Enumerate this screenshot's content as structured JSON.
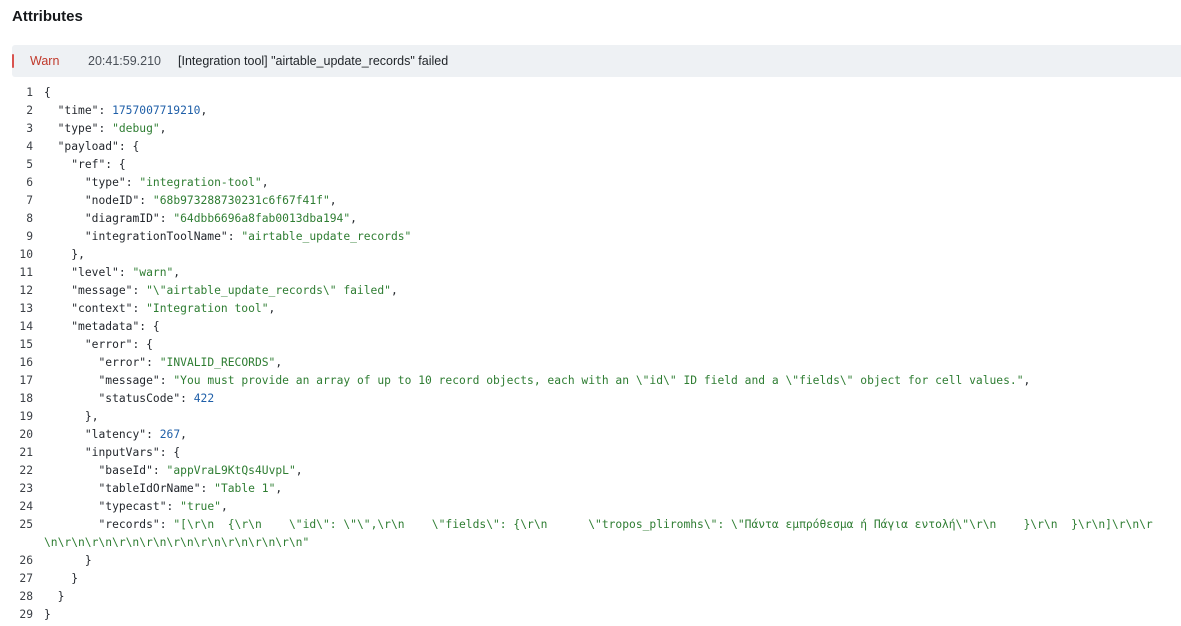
{
  "section": {
    "title": "Attributes"
  },
  "log": {
    "level": "Warn",
    "time": "20:41:59.210",
    "message": "[Integration tool] \"airtable_update_records\" failed",
    "accent_color": "#d9534f"
  },
  "code": {
    "line_numbers": [
      "1",
      "2",
      "3",
      "4",
      "5",
      "6",
      "7",
      "8",
      "9",
      "10",
      "11",
      "12",
      "13",
      "14",
      "15",
      "16",
      "17",
      "18",
      "19",
      "20",
      "21",
      "22",
      "23",
      "24",
      "25",
      "26",
      "27",
      "28",
      "29"
    ],
    "lines": [
      "{",
      "  \"time\": 1757007719210,",
      "  \"type\": \"debug\",",
      "  \"payload\": {",
      "    \"ref\": {",
      "      \"type\": \"integration-tool\",",
      "      \"nodeID\": \"68b973288730231c6f67f41f\",",
      "      \"diagramID\": \"64dbb6696a8fab0013dba194\",",
      "      \"integrationToolName\": \"airtable_update_records\"",
      "    },",
      "    \"level\": \"warn\",",
      "    \"message\": \"\\\"airtable_update_records\\\" failed\",",
      "    \"context\": \"Integration tool\",",
      "    \"metadata\": {",
      "      \"error\": {",
      "        \"error\": \"INVALID_RECORDS\",",
      "        \"message\": \"You must provide an array of up to 10 record objects, each with an \\\"id\\\" ID field and a \\\"fields\\\" object for cell values.\",",
      "        \"statusCode\": 422",
      "      },",
      "      \"latency\": 267,",
      "      \"inputVars\": {",
      "        \"baseId\": \"appVraL9KtQs4UvpL\",",
      "        \"tableIdOrName\": \"Table 1\",",
      "        \"typecast\": \"true\",",
      "        \"records\": \"[\\r\\n  {\\r\\n    \\\"id\\\": \\\"\\\",\\r\\n    \\\"fields\\\": {\\r\\n      \\\"tropos_pliromhs\\\": \\\"Πάντα εμπρόθεσμα ή Πάγια εντολή\\\"\\r\\n    }\\r\\n  }\\r\\n]\\r\\n\\r\\n\\r\\n\\r\\n\\r\\n\\r\\n\\r\\n\\r\\n\\r\\n\\r\\n\\r\\n\"",
      "      }",
      "    }",
      "  }",
      "}"
    ]
  }
}
